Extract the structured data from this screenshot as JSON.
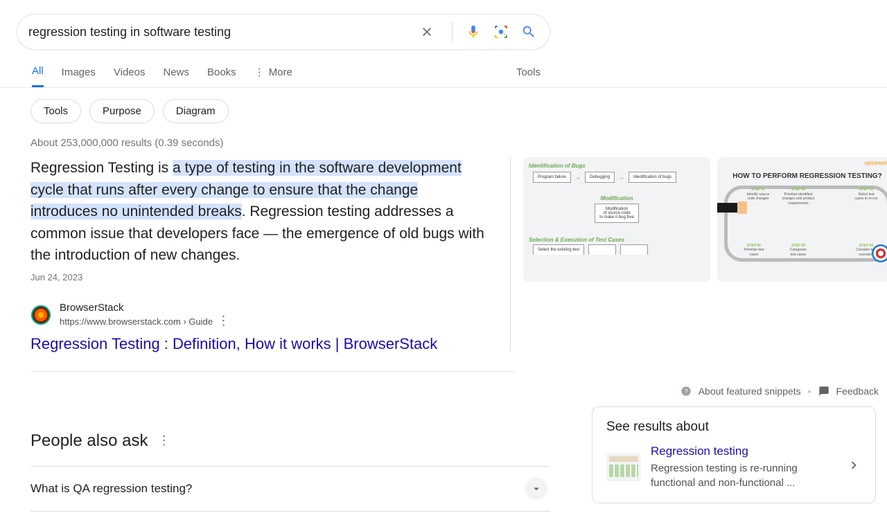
{
  "search": {
    "query": "regression testing in software testing"
  },
  "tabs": {
    "all": "All",
    "images": "Images",
    "videos": "Videos",
    "news": "News",
    "books": "Books",
    "more": "More",
    "tools": "Tools"
  },
  "chips": {
    "c0": "Tools",
    "c1": "Purpose",
    "c2": "Diagram"
  },
  "stats": "About 253,000,000 results (0.39 seconds)",
  "snippet": {
    "pre": "Regression Testing is ",
    "hl": "a type of testing in the software development cycle that runs after every change to ensure that the change introduces no unintended breaks",
    "post": ". Regression testing addresses a common issue that developers face — the emergence of old bugs with the introduction of new changes.",
    "date": "Jun 24, 2023"
  },
  "source": {
    "name": "BrowserStack",
    "url": "https://www.browserstack.com › Guide",
    "title": "Regression Testing : Definition, How it works | BrowserStack"
  },
  "thumb1": {
    "sec1_title": "Identification of Bugs",
    "b1": "Program failure",
    "b2": "Debugging",
    "b3": "Identification of bugs",
    "sec2_title": "Modification",
    "b4a": "Modification",
    "b4b": "of source code",
    "b4c": "to make it bug free",
    "sec3_title": "Selection & Execution of Test Cases",
    "b5": "Select the existing test"
  },
  "thumb2": {
    "logo": "spiceworks",
    "title": "HOW TO PERFORM REGRESSION TESTING?",
    "s1": {
      "h": "STEP 01",
      "a": "Identify source",
      "b": "code changes"
    },
    "s2": {
      "h": "STEP 02",
      "a": "Prioritize identified",
      "b": "changes and product",
      "c": "requirements"
    },
    "s3": {
      "h": "STEP 03",
      "a": "Select test",
      "b": "cases to re-run"
    },
    "s4": {
      "h": "STEP 04",
      "a": "Consider test",
      "b": "scenarios"
    },
    "s5": {
      "h": "STEP 05",
      "a": "Categorize",
      "b": "test cases"
    },
    "s6": {
      "h": "STEP 06",
      "a": "Prioritize test",
      "b": "cases"
    }
  },
  "feedback": {
    "about": "About featured snippets",
    "fb": "Feedback"
  },
  "paa": {
    "title": "People also ask",
    "q1": "What is QA regression testing?"
  },
  "kp": {
    "title": "See results about",
    "link": "Regression testing",
    "desc": "Regression testing is re-running functional and non-functional ..."
  }
}
